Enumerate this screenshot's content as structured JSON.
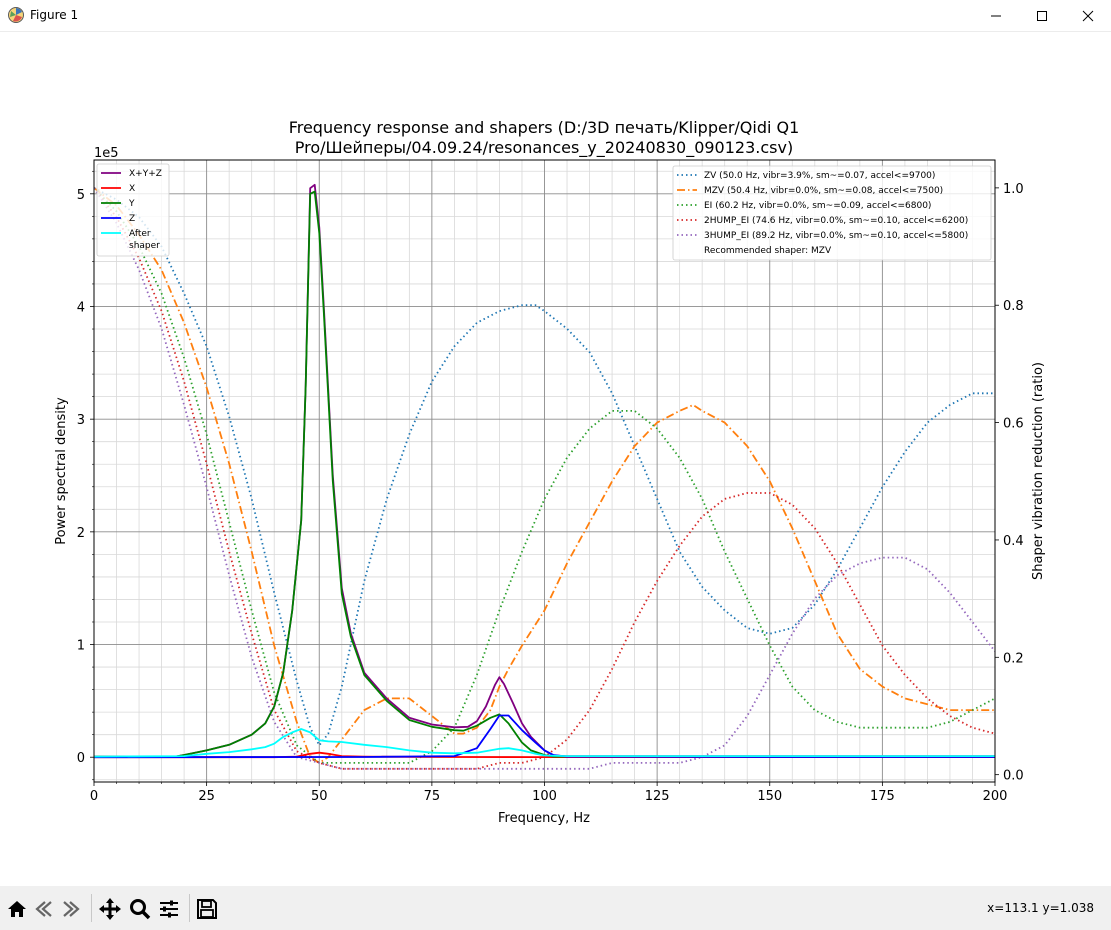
{
  "window": {
    "title": "Figure 1",
    "icons": {
      "app": "matplotlib-icon",
      "minimize": "minimize-icon",
      "maximize": "maximize-icon",
      "close": "close-icon"
    }
  },
  "toolbar": {
    "buttons": [
      {
        "name": "home-icon"
      },
      {
        "name": "back-icon"
      },
      {
        "name": "forward-icon"
      },
      {
        "name": "pan-icon"
      },
      {
        "name": "zoom-icon"
      },
      {
        "name": "configure-subplots-icon"
      },
      {
        "name": "save-icon"
      }
    ],
    "coordinates": "x=113.1 y=1.038"
  },
  "chart_data": {
    "type": "line",
    "title_line1": "Frequency response and shapers (D:/3D печать/Klipper/Qidi Q1",
    "title_line2": "Pro/Шейперы/04.09.24/resonances_y_20240830_090123.csv)",
    "xlabel": "Frequency, Hz",
    "ylabel": "Power spectral density",
    "y2label": "Shaper vibration reduction (ratio)",
    "y_offset_text": "1e5",
    "xlim": [
      0,
      200
    ],
    "ylim": [
      -22000,
      530000
    ],
    "y2lim": [
      -0.0125,
      1.0475
    ],
    "x_ticks": [
      0,
      25,
      50,
      75,
      100,
      125,
      150,
      175,
      200
    ],
    "x_tick_labels": [
      "0",
      "25",
      "50",
      "75",
      "100",
      "125",
      "150",
      "175",
      "200"
    ],
    "y_ticks": [
      0,
      100000,
      200000,
      300000,
      400000,
      500000
    ],
    "y_tick_labels": [
      "0",
      "1",
      "2",
      "3",
      "4",
      "5"
    ],
    "y2_ticks": [
      0,
      0.2,
      0.4,
      0.6,
      0.8,
      1.0
    ],
    "y2_tick_labels": [
      "0.0",
      "0.2",
      "0.4",
      "0.6",
      "0.8",
      "1.0"
    ],
    "grid": true,
    "legend_left": "top-left",
    "legend_right": "top-right",
    "psd_series": [
      {
        "name": "X+Y+Z",
        "color": "#800080",
        "x": [
          0,
          18,
          20,
          25,
          30,
          35,
          38,
          40,
          42,
          44,
          46,
          47,
          48,
          49,
          50,
          51,
          53,
          55,
          57,
          60,
          65,
          70,
          75,
          80,
          83,
          85,
          87,
          89,
          90,
          91,
          93,
          95,
          97,
          100,
          102,
          105,
          150,
          200
        ],
        "y": [
          500,
          500,
          2000,
          6000,
          11000,
          20000,
          30000,
          45000,
          75000,
          130000,
          210000,
          330000,
          505000,
          508000,
          470000,
          400000,
          250000,
          150000,
          110000,
          75000,
          52000,
          35000,
          29000,
          26500,
          27000,
          32000,
          45000,
          64000,
          71000,
          65000,
          48000,
          30000,
          18000,
          6000,
          1500,
          1000,
          1000,
          1000
        ]
      },
      {
        "name": "X",
        "color": "#ff0000",
        "x": [
          0,
          40,
          45,
          48,
          50,
          52,
          55,
          60,
          70,
          80,
          100,
          150,
          200
        ],
        "y": [
          0,
          0,
          500,
          3000,
          4000,
          3000,
          1000,
          500,
          300,
          200,
          100,
          100,
          100
        ]
      },
      {
        "name": "Y",
        "color": "#008000",
        "x": [
          0,
          18,
          20,
          25,
          30,
          35,
          38,
          40,
          42,
          44,
          46,
          47,
          48,
          49,
          50,
          51,
          53,
          55,
          57,
          60,
          65,
          70,
          75,
          80,
          82,
          85,
          88,
          90,
          92,
          95,
          97,
          100,
          102,
          105,
          150,
          200
        ],
        "y": [
          500,
          500,
          2000,
          6000,
          11000,
          20000,
          30000,
          45000,
          75000,
          130000,
          210000,
          330000,
          500000,
          502000,
          465000,
          395000,
          245000,
          145000,
          107000,
          73000,
          50000,
          33000,
          27000,
          24000,
          23500,
          28000,
          35000,
          38000,
          30000,
          13000,
          6000,
          2000,
          500,
          500,
          500,
          500
        ]
      },
      {
        "name": "Z",
        "color": "#0000ff",
        "x": [
          0,
          60,
          80,
          85,
          88,
          90,
          92,
          95,
          98,
          100,
          102,
          105,
          150,
          200
        ],
        "y": [
          0,
          200,
          1000,
          8000,
          25000,
          37000,
          37000,
          24000,
          13000,
          6000,
          2000,
          500,
          200,
          200
        ]
      },
      {
        "name": "After\nshaper",
        "color": "#00ffff",
        "x": [
          0,
          20,
          25,
          30,
          35,
          38,
          40,
          42,
          44,
          46,
          48,
          50,
          52,
          55,
          60,
          65,
          70,
          75,
          80,
          85,
          90,
          92,
          95,
          98,
          100,
          105,
          150,
          200
        ],
        "y": [
          500,
          1000,
          3000,
          4500,
          7000,
          9000,
          12000,
          18000,
          22000,
          25000,
          22000,
          15000,
          14000,
          13500,
          11000,
          9000,
          6000,
          4000,
          3500,
          4000,
          7500,
          8000,
          6000,
          3000,
          1500,
          1000,
          1000,
          1000
        ]
      }
    ],
    "shaper_series": [
      {
        "name": "ZV (50.0 Hz, vibr=3.9%, sm~=0.07, accel<=9700)",
        "color": "#1f77b4",
        "dash": "1.5,3",
        "dash_label": "dotted",
        "x": [
          0,
          5,
          10,
          15,
          20,
          25,
          30,
          35,
          40,
          45,
          48,
          50,
          52,
          55,
          60,
          65,
          70,
          75,
          80,
          85,
          90,
          95,
          98,
          100,
          105,
          110,
          115,
          120,
          125,
          130,
          135,
          140,
          145,
          150,
          155,
          160,
          165,
          170,
          175,
          180,
          185,
          190,
          195,
          200
        ],
        "y": [
          1.0,
          0.98,
          0.95,
          0.9,
          0.82,
          0.73,
          0.61,
          0.47,
          0.31,
          0.16,
          0.08,
          0.05,
          0.07,
          0.15,
          0.33,
          0.47,
          0.58,
          0.67,
          0.73,
          0.77,
          0.79,
          0.8,
          0.8,
          0.79,
          0.76,
          0.72,
          0.65,
          0.56,
          0.47,
          0.38,
          0.32,
          0.28,
          0.25,
          0.24,
          0.25,
          0.29,
          0.35,
          0.42,
          0.49,
          0.55,
          0.6,
          0.63,
          0.65,
          0.65
        ]
      },
      {
        "name": "MZV (50.4 Hz, vibr=0.0%, sm~=0.08, accel<=7500)",
        "color": "#ff7f0e",
        "dash": "8,3,1.5,3",
        "dash_label": "dash-dot",
        "x": [
          0,
          5,
          10,
          15,
          20,
          25,
          30,
          35,
          40,
          45,
          48,
          50,
          52,
          55,
          60,
          65,
          68,
          70,
          75,
          80,
          82,
          85,
          88,
          90,
          92,
          95,
          100,
          105,
          110,
          115,
          120,
          125,
          130,
          133,
          135,
          140,
          145,
          150,
          155,
          160,
          165,
          170,
          175,
          180,
          185,
          190,
          195,
          200
        ],
        "y": [
          1.0,
          0.97,
          0.92,
          0.86,
          0.77,
          0.66,
          0.53,
          0.38,
          0.22,
          0.09,
          0.03,
          0.02,
          0.03,
          0.06,
          0.11,
          0.13,
          0.13,
          0.13,
          0.1,
          0.07,
          0.07,
          0.08,
          0.11,
          0.15,
          0.18,
          0.22,
          0.28,
          0.36,
          0.43,
          0.5,
          0.56,
          0.6,
          0.62,
          0.63,
          0.62,
          0.6,
          0.56,
          0.5,
          0.42,
          0.33,
          0.24,
          0.18,
          0.15,
          0.13,
          0.12,
          0.11,
          0.11,
          0.11
        ]
      },
      {
        "name": "EI (60.2 Hz, vibr=0.0%, sm~=0.09, accel<=6800)",
        "color": "#2ca02c",
        "dash": "1.5,3",
        "dash_label": "dotted",
        "x": [
          0,
          5,
          10,
          15,
          20,
          25,
          30,
          35,
          40,
          45,
          50,
          55,
          60,
          65,
          70,
          75,
          80,
          85,
          90,
          95,
          100,
          105,
          110,
          115,
          118,
          120,
          125,
          130,
          135,
          140,
          145,
          150,
          155,
          160,
          165,
          170,
          175,
          180,
          185,
          190,
          195,
          200
        ],
        "y": [
          1.0,
          0.96,
          0.9,
          0.82,
          0.71,
          0.58,
          0.43,
          0.28,
          0.14,
          0.05,
          0.02,
          0.02,
          0.02,
          0.02,
          0.02,
          0.04,
          0.08,
          0.17,
          0.28,
          0.38,
          0.47,
          0.54,
          0.59,
          0.62,
          0.62,
          0.62,
          0.59,
          0.54,
          0.47,
          0.38,
          0.3,
          0.22,
          0.15,
          0.11,
          0.09,
          0.08,
          0.08,
          0.08,
          0.08,
          0.09,
          0.11,
          0.13
        ]
      },
      {
        "name": "2HUMP_EI (74.6 Hz, vibr=0.0%, sm~=0.10, accel<=6200)",
        "color": "#d62728",
        "dash": "1.5,3",
        "dash_label": "dotted",
        "x": [
          0,
          5,
          10,
          15,
          20,
          25,
          30,
          35,
          40,
          45,
          50,
          55,
          60,
          65,
          70,
          75,
          80,
          85,
          90,
          95,
          100,
          105,
          110,
          115,
          120,
          125,
          130,
          135,
          140,
          145,
          148,
          150,
          155,
          160,
          165,
          170,
          175,
          180,
          185,
          190,
          195,
          200
        ],
        "y": [
          1.0,
          0.95,
          0.88,
          0.79,
          0.67,
          0.53,
          0.38,
          0.24,
          0.11,
          0.04,
          0.02,
          0.01,
          0.01,
          0.01,
          0.01,
          0.01,
          0.01,
          0.01,
          0.02,
          0.02,
          0.03,
          0.06,
          0.11,
          0.18,
          0.26,
          0.33,
          0.39,
          0.44,
          0.47,
          0.48,
          0.48,
          0.48,
          0.46,
          0.42,
          0.36,
          0.29,
          0.22,
          0.17,
          0.13,
          0.1,
          0.08,
          0.07
        ]
      },
      {
        "name": "3HUMP_EI (89.2 Hz, vibr=0.0%, sm~=0.10, accel<=5800)",
        "color": "#9467bd",
        "dash": "1.5,3",
        "dash_label": "dotted",
        "x": [
          0,
          5,
          10,
          15,
          20,
          25,
          30,
          35,
          40,
          45,
          50,
          55,
          60,
          65,
          70,
          75,
          80,
          85,
          90,
          95,
          100,
          105,
          110,
          115,
          120,
          125,
          130,
          135,
          140,
          145,
          150,
          155,
          160,
          165,
          170,
          175,
          180,
          185,
          190,
          195,
          200
        ],
        "y": [
          1.0,
          0.94,
          0.86,
          0.76,
          0.63,
          0.49,
          0.34,
          0.2,
          0.09,
          0.03,
          0.02,
          0.01,
          0.01,
          0.01,
          0.01,
          0.01,
          0.01,
          0.01,
          0.01,
          0.01,
          0.01,
          0.01,
          0.01,
          0.02,
          0.02,
          0.02,
          0.02,
          0.03,
          0.05,
          0.1,
          0.17,
          0.24,
          0.3,
          0.34,
          0.36,
          0.37,
          0.37,
          0.35,
          0.31,
          0.26,
          0.21
        ]
      }
    ],
    "recommended_text": "Recommended shaper: MZV"
  }
}
